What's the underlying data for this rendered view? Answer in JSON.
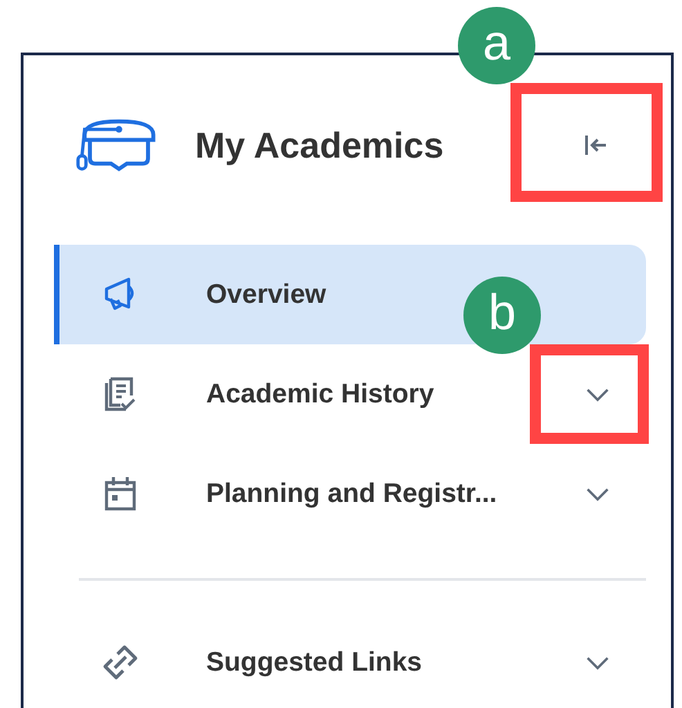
{
  "panel": {
    "title": "My Academics"
  },
  "sections": [
    {
      "items": [
        {
          "label": "Overview",
          "selected": true,
          "expandable": false
        },
        {
          "label": "Academic History",
          "selected": false,
          "expandable": true
        },
        {
          "label": "Planning and Registr...",
          "selected": false,
          "expandable": true
        }
      ]
    },
    {
      "items": [
        {
          "label": "Suggested Links",
          "selected": false,
          "expandable": true
        }
      ]
    }
  ],
  "callouts": [
    {
      "label": "a"
    },
    {
      "label": "b"
    }
  ]
}
